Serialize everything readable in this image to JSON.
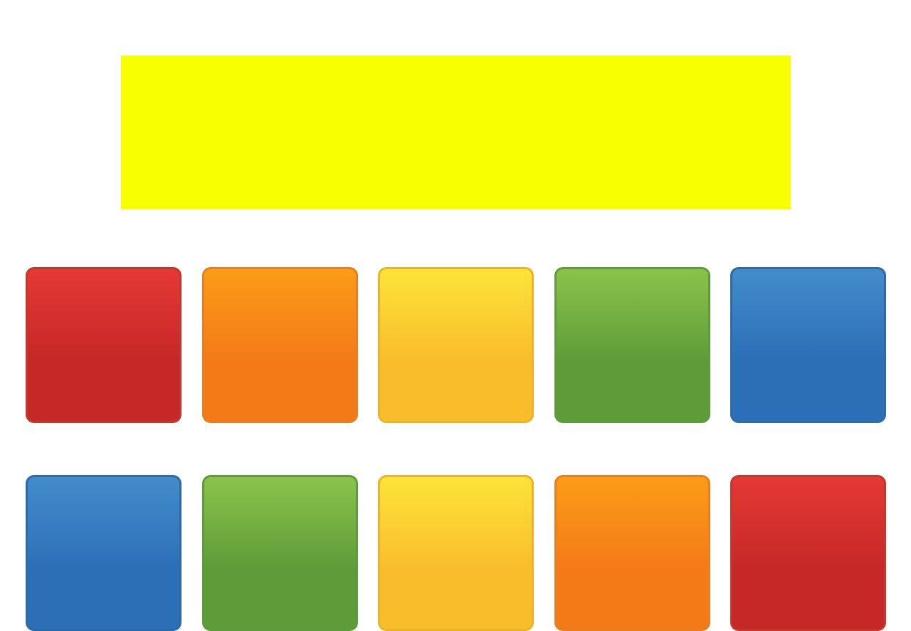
{
  "target": {
    "color": "#f8ff00"
  },
  "tile_colors": {
    "red": {
      "top": "#e53935",
      "bottom": "#c62828",
      "border": "#c0392b"
    },
    "orange": {
      "top": "#fb9c17",
      "bottom": "#f47a18",
      "border": "#e67e22"
    },
    "yellow": {
      "top": "#fde43a",
      "bottom": "#f9bd2b",
      "border": "#e8b52a"
    },
    "green": {
      "top": "#8bc34a",
      "bottom": "#5e9c3a",
      "border": "#5f9b3d"
    },
    "blue": {
      "top": "#438ccb",
      "bottom": "#2d6fb7",
      "border": "#2c6aa8"
    }
  },
  "rows": [
    [
      "red",
      "orange",
      "yellow",
      "green",
      "blue"
    ],
    [
      "blue",
      "green",
      "yellow",
      "orange",
      "red"
    ]
  ]
}
